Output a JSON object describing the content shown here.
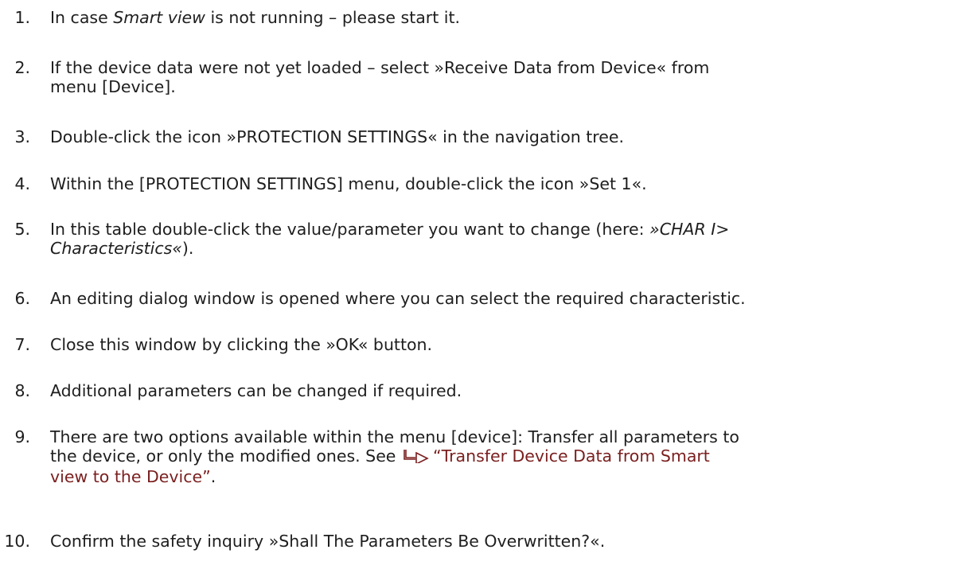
{
  "steps": [
    {
      "num": "1.",
      "t1": "In case ",
      "em1": "Smart view",
      "t2": " is not running – please start it."
    },
    {
      "num": "2.",
      "line1": "If the device data were not yet loaded – select »Receive Data from Device« from",
      "line2": "menu [Device]."
    },
    {
      "num": "3.",
      "text": "Double-click the icon »PROTECTION SETTINGS« in the navigation tree."
    },
    {
      "num": "4.",
      "text": "Within the [PROTECTION SETTINGS] menu, double-click the icon »Set 1«."
    },
    {
      "num": "5.",
      "t1": "In this table double-click the value/parameter you want to change (here: ",
      "em1": "»CHAR I>",
      "em2": "Characteristics«",
      "t2": ")."
    },
    {
      "num": "6.",
      "text": "An editing dialog window is opened where you can select the required characteristic."
    },
    {
      "num": "7.",
      "text": "Close this window by clicking the »OK« button."
    },
    {
      "num": "8.",
      "text": "Additional parameters can be changed if required."
    },
    {
      "num": "9.",
      "line1": "There are two options available within the menu [device]: Transfer all parameters to",
      "line2_pre": "the device, or only the modified ones. See ",
      "link_a": "“Transfer Device Data from Smart",
      "link_b": "view to the Device”",
      "line3_post": ".",
      "link_icon": "cross-reference-arrow-icon",
      "link_color": "#7a1f1f"
    },
    {
      "num": "10.",
      "text": "Confirm the safety inquiry »Shall The Parameters Be Overwritten?«."
    }
  ]
}
